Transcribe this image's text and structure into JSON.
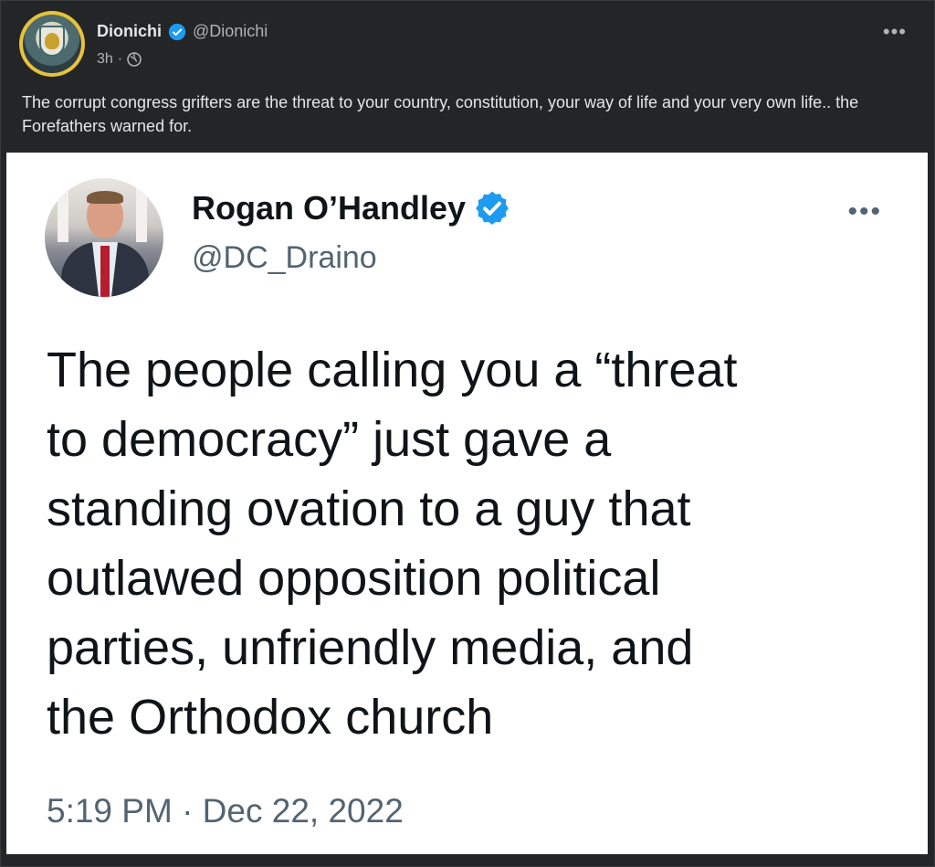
{
  "post": {
    "author_name": "Dionichi",
    "author_handle": "@Dionichi",
    "time_ago": "3h",
    "separator": "·",
    "more_label": "•••",
    "caption": "The corrupt congress grifters are the threat to your country, constitution, your way of life and your very own life.. the Forefathers warned for."
  },
  "tweet": {
    "author_name": "Rogan O’Handley",
    "author_handle": "@DC_Draino",
    "more_label": "•••",
    "body": "The people calling you a “threat\nto democracy” just gave a\nstanding ovation to a guy that\noutlawed opposition political\nparties, unfriendly media, and\nthe Orthodox church",
    "timestamp": "5:19 PM · Dec 22, 2022"
  },
  "colors": {
    "background": "#242526",
    "verified": "#1d9bf0",
    "avatar_ring": "#e8c33a"
  },
  "icons": [
    "verified-badge-icon",
    "globe-icon",
    "more-options-icon"
  ]
}
